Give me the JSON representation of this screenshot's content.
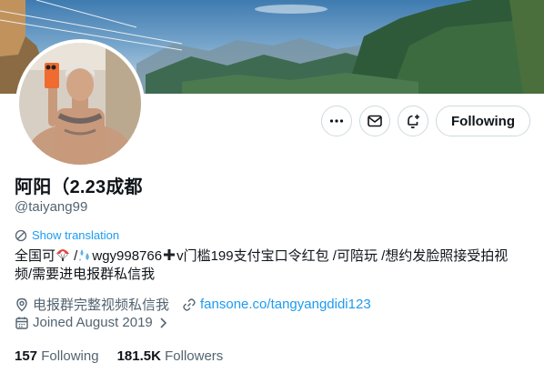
{
  "profile": {
    "display_name": "阿阳（2.23成都",
    "handle": "@taiyang99",
    "show_translation": "Show translation",
    "bio_line1_a": "全国可",
    "bio_line1_b": " /",
    "bio_line1_c": "wgy998766",
    "bio_line1_d": "v门槛199支付宝口令红包 /可陪玩 /想约发脸照接受拍视",
    "bio_line2": "频/需要进电报群私信我",
    "location": "电报群完整视频私信我",
    "website": "fansone.co/tangyangdidi123",
    "joined": "Joined August 2019"
  },
  "actions": {
    "more_icon": "more-icon",
    "message_icon": "envelope-icon",
    "notify_icon": "bell-plus-icon",
    "follow_label": "Following"
  },
  "stats": {
    "following_count": "157",
    "following_label": "Following",
    "followers_count": "181.5K",
    "followers_label": "Followers"
  },
  "colors": {
    "accent": "#1d9bf0",
    "text": "#0f1419",
    "secondary": "#536471",
    "border": "#cfd9de"
  }
}
